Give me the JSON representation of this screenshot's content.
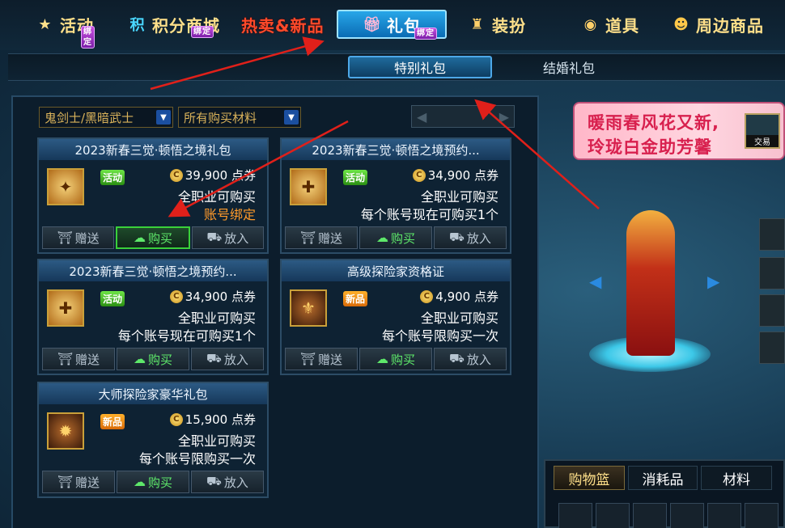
{
  "topnav": {
    "tabs": [
      {
        "label": "活动",
        "badge": "绑定",
        "icon": "star-medal-icon"
      },
      {
        "label": "积分商城",
        "badge": "绑定",
        "icon_text": "积"
      },
      {
        "label": "热卖&新品"
      },
      {
        "label": "礼包",
        "badge": "绑定",
        "icon": "gift-box-icon",
        "active": true
      },
      {
        "label": "装扮",
        "icon": "trophy-icon"
      },
      {
        "label": "道具",
        "icon": "orb-icon"
      },
      {
        "label": "周边商品",
        "icon": "mascot-icon"
      }
    ]
  },
  "subnav": {
    "tabs": [
      {
        "label": "特别礼包",
        "active": true
      },
      {
        "label": "结婚礼包"
      }
    ]
  },
  "filters": {
    "job": "鬼剑士/黑暗武士",
    "material": "所有购买材料"
  },
  "cards": [
    {
      "title": "2023新春三觉·顿悟之境礼包",
      "tag": "活动",
      "price": "39,900 点券",
      "line1": "全职业可购买",
      "line2": "账号绑定",
      "buy": "购买",
      "gift": "赠送",
      "cart": "放入"
    },
    {
      "title": "2023新春三觉·顿悟之境预约...",
      "tag": "活动",
      "price": "34,900 点券",
      "line1": "全职业可购买",
      "line2": "每个账号现在可购买1个",
      "buy": "购买",
      "gift": "赠送",
      "cart": "放入"
    },
    {
      "title": "2023新春三觉·顿悟之境预约...",
      "tag": "活动",
      "price": "34,900 点券",
      "line1": "全职业可购买",
      "line2": "每个账号现在可购买1个",
      "buy": "购买",
      "gift": "赠送",
      "cart": "放入"
    },
    {
      "title": "高级探险家资格证",
      "tag": "新品",
      "price": "4,900 点券",
      "line1": "全职业可购买",
      "line2": "每个账号限购买一次",
      "buy": "购买",
      "gift": "赠送",
      "cart": "放入"
    },
    {
      "title": "大师探险家豪华礼包",
      "tag": "新品",
      "price": "15,900 点券",
      "line1": "全职业可购买",
      "line2": "每个账号限购买一次",
      "buy": "购买",
      "gift": "赠送",
      "cart": "放入"
    }
  ],
  "banner": {
    "line1": "暖雨春风花又新,",
    "line2": "玲珑白金助芳馨",
    "badge": "交易"
  },
  "bottom_tabs": [
    "购物篮",
    "消耗品",
    "材料"
  ],
  "colors": {
    "accent_blue": "#28a6e8",
    "price_gold": "#ffe27a",
    "buy_green": "#5ee86a",
    "bind_orange": "#ff9a2a",
    "annotation_red": "#e0201a"
  }
}
